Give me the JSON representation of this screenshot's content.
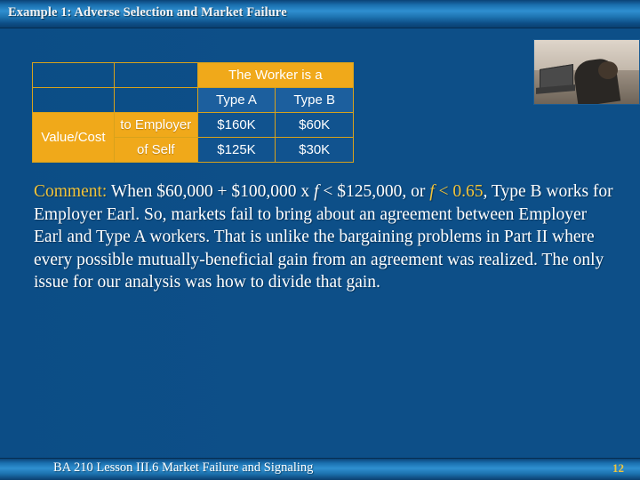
{
  "slide": {
    "title": "Example 1: Adverse Selection and Market Failure",
    "footer_text": "BA 210  Lesson III.6 Market Failure and Signaling",
    "page_number": "12"
  },
  "table": {
    "header_span": "The Worker is a",
    "columns": [
      "Type A",
      "Type B"
    ],
    "row_label": "Value/Cost",
    "rows": [
      {
        "label": "to Employer",
        "values": [
          "$160K",
          "$60K"
        ]
      },
      {
        "label": "of Self",
        "values": [
          "$125K",
          "$30K"
        ]
      }
    ]
  },
  "body": {
    "lead_label": "Comment:",
    "part1": " When $60,000 + $100,000 x ",
    "f1": "f",
    "part2": " < $125,000, or ",
    "f2": "f",
    "part3": " < ",
    "threshold": "0.65",
    "part4": ", Type B works for Employer Earl.  So, markets fail to bring about an agreement between Employer Earl and Type A workers.  That is unlike the bargaining problems in Part II where every possible mutually-beneficial gain from an agreement was realized.  The only issue for our analysis was how to divide that gain."
  },
  "photo": {
    "alt": "person-at-desk-with-laptop-photo"
  },
  "colors": {
    "background": "#0d4f88",
    "accent_amber": "#f0a91a",
    "highlight_text": "#f2c43a",
    "table_cell_blue": "#1c5f9e"
  }
}
